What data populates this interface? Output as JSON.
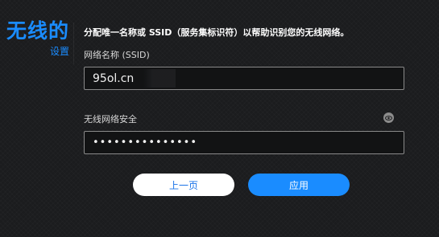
{
  "page": {
    "title_main": "无线的",
    "title_sub": "设置",
    "description": "分配唯一名称或 SSID（服务集标识符）以帮助识别您的无线网络。"
  },
  "ssid": {
    "label": "网络名称 (SSID)",
    "value": "95ol.cn"
  },
  "security": {
    "label": "无线网络安全",
    "value": "•••••••••••••••",
    "toggle_icon": "eye-icon"
  },
  "buttons": {
    "prev_label": "上一页",
    "apply_label": "应用"
  },
  "colors": {
    "accent": "#1a8cff",
    "background": "#1b1c1e",
    "button_secondary_bg": "#ffffff"
  }
}
